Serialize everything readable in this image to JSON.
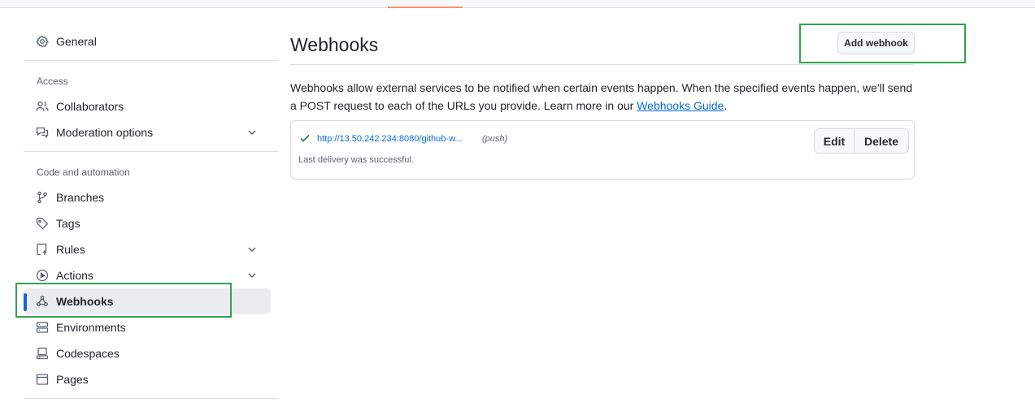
{
  "sidebar": {
    "general": "General",
    "access_heading": "Access",
    "collaborators": "Collaborators",
    "moderation": "Moderation options",
    "code_heading": "Code and automation",
    "branches": "Branches",
    "tags": "Tags",
    "rules": "Rules",
    "actions": "Actions",
    "webhooks": "Webhooks",
    "environments": "Environments",
    "codespaces": "Codespaces",
    "pages": "Pages"
  },
  "main": {
    "title": "Webhooks",
    "add_button": "Add webhook",
    "description_prefix": "Webhooks allow external services to be notified when certain events happen. When the specified events happen, we'll send a POST request to each of the URLs you provide. Learn more in our ",
    "guide_link": "Webhooks Guide",
    "description_suffix": ".",
    "webhook": {
      "url": "http://13.50.242.234:8080/github-w...",
      "event": "(push)",
      "status": "Last delivery was successful.",
      "edit_label": "Edit",
      "delete_label": "Delete"
    }
  },
  "colors": {
    "accent": "#0969da",
    "success": "#1a7f37",
    "highlight": "#2ea44f",
    "tab_underline": "#fd8c73"
  },
  "icons": [
    "gear-icon",
    "people-icon",
    "comment-discussion-icon",
    "git-branch-icon",
    "tag-icon",
    "repo-push-icon",
    "play-icon",
    "webhook-icon",
    "server-icon",
    "codespaces-icon",
    "browser-icon",
    "check-icon",
    "chevron-down-icon"
  ]
}
